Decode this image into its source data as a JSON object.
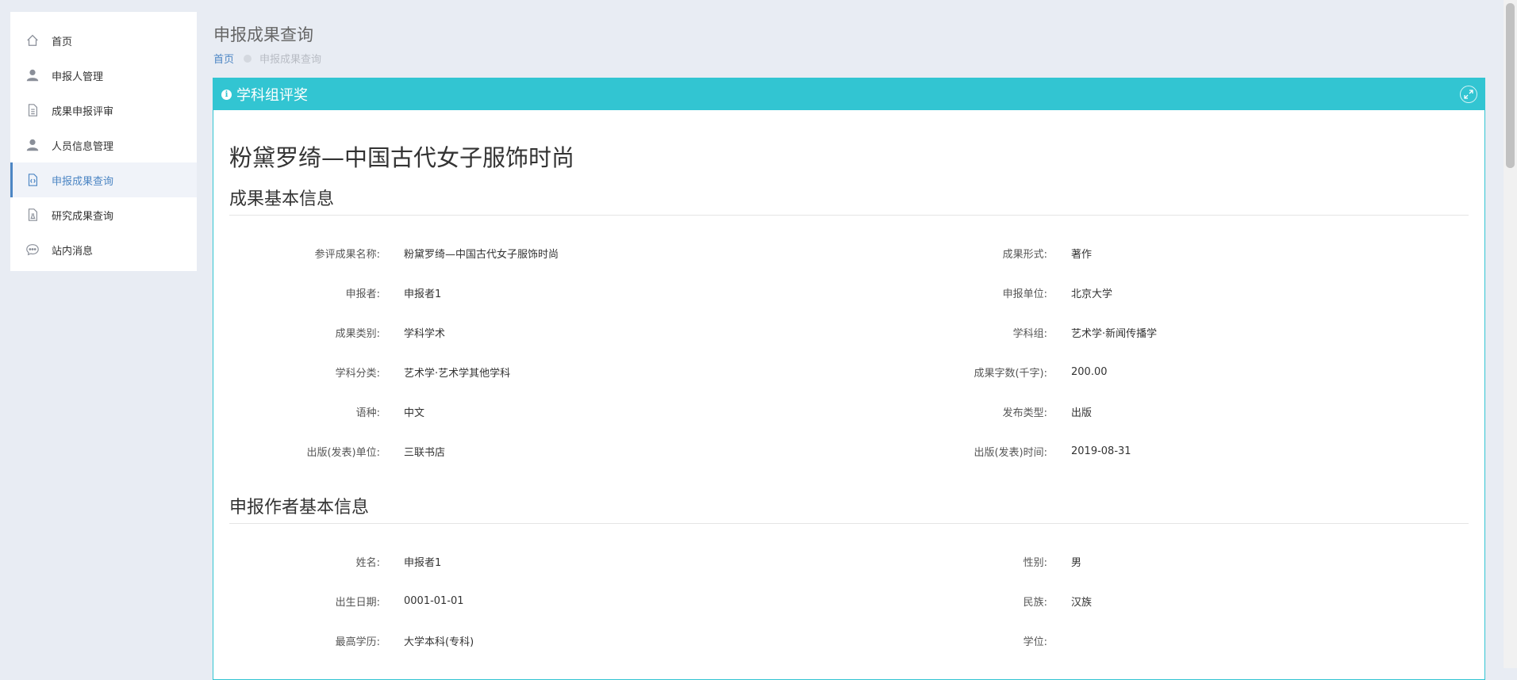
{
  "sidebar": {
    "items": [
      {
        "label": "首页",
        "icon": "home-icon"
      },
      {
        "label": "申报人管理",
        "icon": "user-icon"
      },
      {
        "label": "成果申报评审",
        "icon": "document-icon"
      },
      {
        "label": "人员信息管理",
        "icon": "user-icon"
      },
      {
        "label": "申报成果查询",
        "icon": "code-file-icon",
        "active": true
      },
      {
        "label": "研究成果查询",
        "icon": "flask-file-icon"
      },
      {
        "label": "站内消息",
        "icon": "chat-icon"
      }
    ]
  },
  "page": {
    "title": "申报成果查询",
    "breadcrumb": {
      "home": "首页",
      "current": "申报成果查询"
    }
  },
  "panel": {
    "title": "学科组评奖",
    "achievement_title": "粉黛罗绮—中国古代女子服饰时尚",
    "basic_section": {
      "title": "成果基本信息",
      "rows": [
        [
          {
            "label": "参评成果名称:",
            "value": "粉黛罗绮—中国古代女子服饰时尚"
          },
          {
            "label": "成果形式:",
            "value": "著作"
          }
        ],
        [
          {
            "label": "申报者:",
            "value": "申报者1"
          },
          {
            "label": "申报单位:",
            "value": "北京大学"
          }
        ],
        [
          {
            "label": "成果类别:",
            "value": "学科学术"
          },
          {
            "label": "学科组:",
            "value": "艺术学·新闻传播学"
          }
        ],
        [
          {
            "label": "学科分类:",
            "value": "艺术学·艺术学其他学科"
          },
          {
            "label": "成果字数(千字):",
            "value": "200.00"
          }
        ],
        [
          {
            "label": "语种:",
            "value": "中文"
          },
          {
            "label": "发布类型:",
            "value": "出版"
          }
        ],
        [
          {
            "label": "出版(发表)单位:",
            "value": "三联书店"
          },
          {
            "label": "出版(发表)时间:",
            "value": "2019-08-31"
          }
        ]
      ]
    },
    "author_section": {
      "title": "申报作者基本信息",
      "rows": [
        [
          {
            "label": "姓名:",
            "value": "申报者1"
          },
          {
            "label": "性别:",
            "value": "男"
          }
        ],
        [
          {
            "label": "出生日期:",
            "value": "0001-01-01"
          },
          {
            "label": "民族:",
            "value": "汉族"
          }
        ],
        [
          {
            "label": "最高学历:",
            "value": "大学本科(专科)"
          },
          {
            "label": "学位:",
            "value": ""
          }
        ]
      ]
    }
  },
  "colors": {
    "panel_header": "#32c5d2",
    "accent": "#4d86c4",
    "background": "#e8ecf3"
  }
}
